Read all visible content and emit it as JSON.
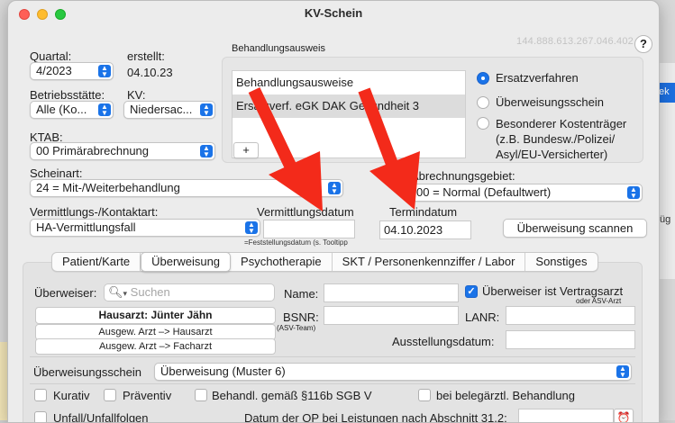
{
  "window": {
    "title": "KV-Schein",
    "ip": "144.888.613.267.046.402",
    "help": "?"
  },
  "background": {
    "right_item": "ek",
    "right_item2": "füg"
  },
  "quartal": {
    "label": "Quartal:",
    "value": "4/2023"
  },
  "erstellt": {
    "label": "erstellt:",
    "value": "04.10.23"
  },
  "betriebsstaette": {
    "label": "Betriebsstätte:",
    "value": "Alle (Ko..."
  },
  "kv": {
    "label": "KV:",
    "value": "Niedersac..."
  },
  "ktab": {
    "label": "KTAB:",
    "value": "00 Primärabrechnung"
  },
  "behandlungsausweis": {
    "group_label": "Behandlungsausweis",
    "header": "Behandlungsausweise",
    "rows": [
      "Ersatzverf. eGK DAK Gesundheit 3"
    ],
    "add": "+"
  },
  "kostentraeger": {
    "options": [
      "Ersatzverfahren",
      "Überweisungsschein",
      "Besonderer Kostenträger\n(z.B. Bundesw./Polizei/\nAsyl/EU-Versicherter)"
    ],
    "selected": 0
  },
  "scheinart": {
    "label": "Scheinart:",
    "value": "24 = Mit-/Weiterbehandlung"
  },
  "abrechnungsgebiet": {
    "label": "Abrechnungsgebiet:",
    "value": "00 = Normal (Defaultwert)"
  },
  "vermittlung": {
    "label": "Vermittlungs-/Kontaktart:",
    "value": "HA-Vermittlungsfall"
  },
  "vermittlungsdatum": {
    "label": "Vermittlungsdatum",
    "value": "",
    "hint": "=Feststellungsdatum (s. Tooltipp"
  },
  "termindatum": {
    "label": "Termindatum",
    "value": "04.10.2023"
  },
  "scan_button": "Überweisung scannen",
  "tabs": [
    "Patient/Karte",
    "Überweisung",
    "Psychotherapie",
    "SKT / Personenkennziffer / Labor",
    "Sonstiges"
  ],
  "active_tab": 1,
  "ueberweisung": {
    "ueberweiser_label": "Überweiser:",
    "search_placeholder": "Suchen",
    "hausarzt_btn": "Hausarzt: Jünter Jähn",
    "btn2": "Ausgew. Arzt –> Hausarzt",
    "btn3": "Ausgew. Arzt –> Facharzt",
    "name_label": "Name:",
    "name_value": "",
    "vertragsarzt_label": "Überweiser ist Vertragsarzt",
    "vertragsarzt_sub": "oder ASV-Arzt",
    "vertragsarzt_checked": true,
    "bsnr_label": "BSNR:",
    "bsnr_sub": "(ASV-Team)",
    "lanr_label": "LANR:",
    "ausstellungsdatum_label": "Ausstellungsdatum:",
    "schein_label": "Überweisungsschein",
    "schein_value": "Überweisung (Muster 6)",
    "kurativ": "Kurativ",
    "praeventiv": "Präventiv",
    "behandl": "Behandl. gemäß  §116b SGB V",
    "beleg": "bei belegärztl. Behandlung",
    "unfall": "Unfall/Unfallfolgen",
    "op_datum_label": "Datum der OP bei Leistungen nach Abschnitt 31.2:"
  },
  "colors": {
    "accent": "#1a73e8",
    "arrow": "#f32a1a"
  }
}
